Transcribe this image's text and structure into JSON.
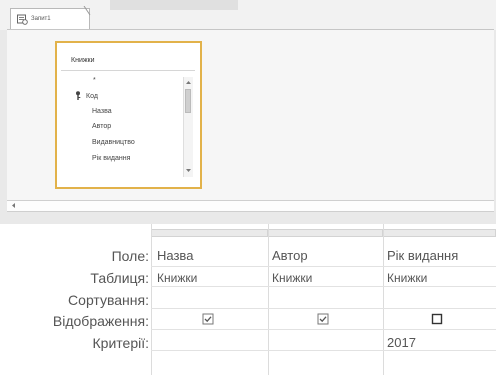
{
  "tab": {
    "label": "Запит1"
  },
  "table": {
    "title": "Книжки",
    "fields": [
      {
        "label": "*",
        "key": false
      },
      {
        "label": "Код",
        "key": true
      },
      {
        "label": "Назва",
        "key": false
      },
      {
        "label": "Автор",
        "key": false
      },
      {
        "label": "Видавництво",
        "key": false
      },
      {
        "label": "Рік видання",
        "key": false
      }
    ]
  },
  "grid": {
    "row_labels": {
      "field": "Поле:",
      "table": "Таблиця:",
      "sort": "Сортування:",
      "show": "Відображення:",
      "criteria": "Критерії:"
    },
    "columns": [
      {
        "field": "Назва",
        "table": "Книжки",
        "sort": "",
        "show": true,
        "criteria": ""
      },
      {
        "field": "Автор",
        "table": "Книжки",
        "sort": "",
        "show": true,
        "criteria": ""
      },
      {
        "field": "Рік видання",
        "table": "Книжки",
        "sort": "",
        "show": false,
        "criteria": "2017"
      }
    ]
  },
  "colors": {
    "table_border": "#e2b24a",
    "text": "#555555"
  },
  "icons": {
    "tab": "query-icon",
    "key": "key-icon",
    "checkbox_checked": "checkbox-checked-icon",
    "checkbox_unchecked": "checkbox-unchecked-icon"
  }
}
